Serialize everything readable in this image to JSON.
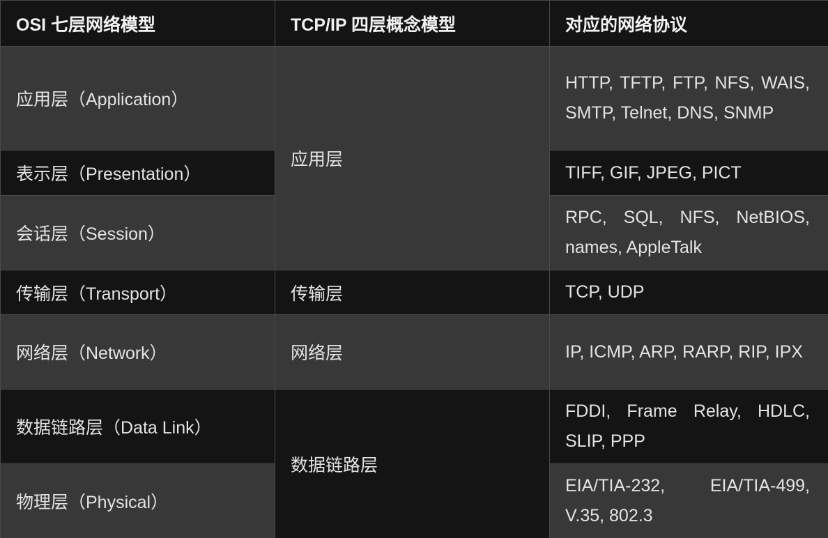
{
  "headers": {
    "osi": "OSI 七层网络模型",
    "tcpip": "TCP/IP 四层概念模型",
    "protocols": "对应的网络协议"
  },
  "osi_layers": [
    "应用层（Application）",
    "表示层（Presentation）",
    "会话层（Session）",
    "传输层（Transport）",
    "网络层（Network）",
    "数据链路层（Data Link）",
    "物理层（Physical）"
  ],
  "tcpip_layers": [
    "应用层",
    "传输层",
    "网络层",
    "数据链路层"
  ],
  "protocols": [
    "HTTP, TFTP, FTP, NFS, WAIS, SMTP, Telnet, DNS, SNMP",
    "TIFF, GIF, JPEG, PICT",
    "RPC, SQL, NFS, NetBIOS, names, AppleTalk",
    "TCP, UDP",
    "IP, ICMP, ARP, RARP, RIP, IPX",
    "FDDI, Frame Relay, HDLC, SLIP, PPP",
    "EIA/TIA-232, EIA/TIA-499, V.35, 802.3"
  ]
}
